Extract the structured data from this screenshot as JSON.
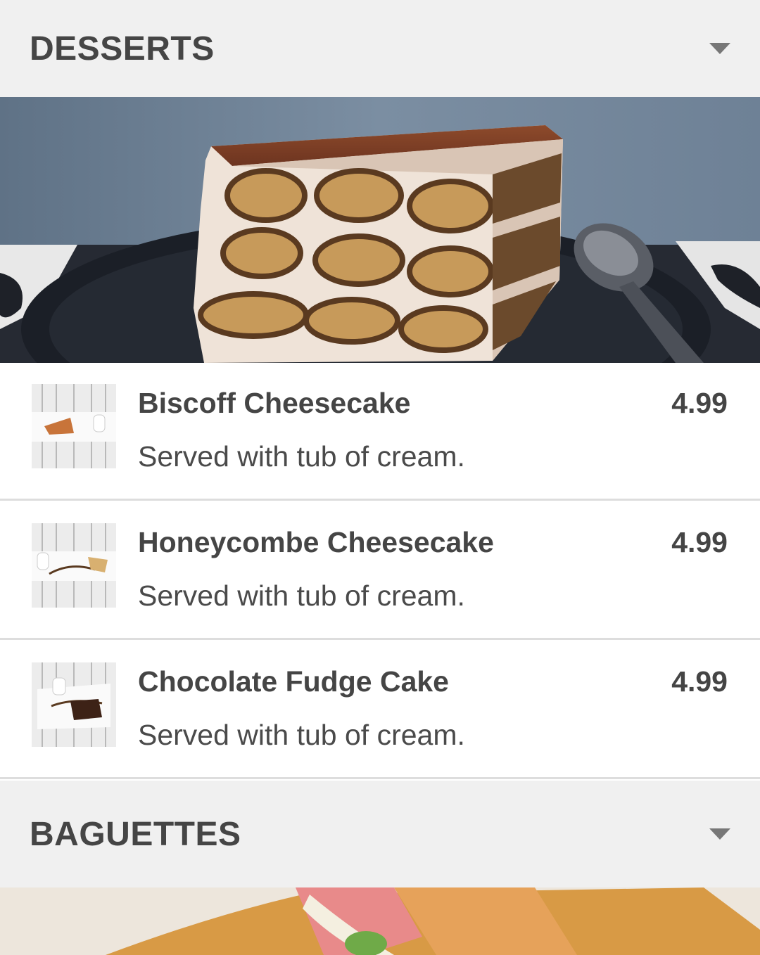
{
  "sections": [
    {
      "title": "DESSERTS",
      "expand_icon": "chevron-down-icon",
      "items": [
        {
          "name": "Biscoff Cheesecake",
          "description": "Served with tub of cream.",
          "price": "4.99"
        },
        {
          "name": "Honeycombe Cheesecake",
          "description": "Served with tub of cream.",
          "price": "4.99"
        },
        {
          "name": "Chocolate Fudge Cake",
          "description": "Served with tub of cream.",
          "price": "4.99"
        }
      ]
    },
    {
      "title": "BAGUETTES",
      "expand_icon": "chevron-down-icon"
    }
  ],
  "colors": {
    "header_bg": "#f0f0f0",
    "text": "#454545",
    "divider": "#dddddd"
  }
}
